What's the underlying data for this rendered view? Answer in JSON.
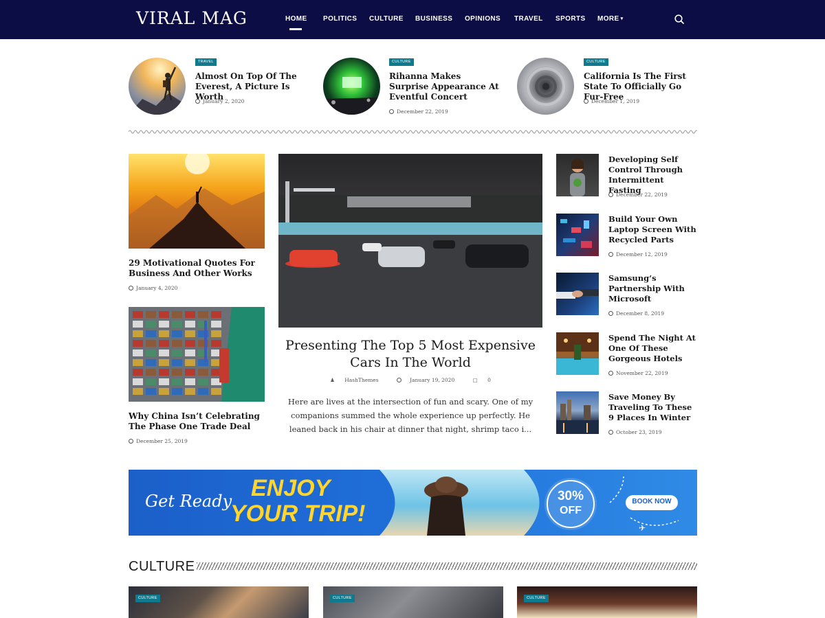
{
  "brand": {
    "logo": "VIRAL MAG"
  },
  "nav": {
    "items": [
      {
        "label": "HOME"
      },
      {
        "label": "POLITICS"
      },
      {
        "label": "CULTURE"
      },
      {
        "label": "BUSINESS"
      },
      {
        "label": "OPINIONS"
      },
      {
        "label": "TRAVEL"
      },
      {
        "label": "SPORTS"
      },
      {
        "label": "MORE"
      }
    ],
    "active": "HOME",
    "search_icon": "search-icon"
  },
  "featured": [
    {
      "category": "TRAVEL",
      "title": "Almost On Top Of The Everest, A Picture Is Worth",
      "date": "January 2, 2020"
    },
    {
      "category": "CULTURE",
      "title": "Rihanna Makes Surprise Appearance At Eventful Concert",
      "date": "December 22, 2019"
    },
    {
      "category": "CULTURE",
      "title": "California Is The First State To Officially Go Fur-Free",
      "date": "December 1, 2019"
    }
  ],
  "left_posts": [
    {
      "title": "29 Motivational Quotes For Business And Other Works",
      "date": "January 4, 2020"
    },
    {
      "title": "Why China Isn’t Celebrating The Phase One Trade Deal",
      "date": "December 25, 2019"
    }
  ],
  "main_post": {
    "title": "Presenting The Top 5 Most Expensive Cars In The World",
    "author": "HashThemes",
    "date": "January 19, 2020",
    "comments": "0",
    "excerpt": "Here are lives at the intersection of fun and scary. One of my companions summed the whole experience up perfectly. He leaned back in his chair at dinner that night, shrimp taco i..."
  },
  "side_posts": [
    {
      "title": "Developing Self Control Through Intermittent Fasting",
      "date": "December 22, 2019"
    },
    {
      "title": "Build Your Own Laptop Screen With Recycled Parts",
      "date": "December 12, 2019"
    },
    {
      "title": "Samsung’s Partnership With Microsoft",
      "date": "December 8, 2019"
    },
    {
      "title": "Spend The Night At One Of These Gorgeous Hotels",
      "date": "November 22, 2019"
    },
    {
      "title": "Save Money By Traveling To These 9 Places In Winter",
      "date": "October 23, 2019"
    }
  ],
  "banner": {
    "tagline": "Get Ready",
    "headline_1": "ENJOY",
    "headline_2": "YOUR TRIP!",
    "discount": "30%",
    "discount_label": "OFF",
    "cta": "BOOK NOW"
  },
  "culture": {
    "title": "CULTURE",
    "cards": [
      {
        "category": "CULTURE"
      },
      {
        "category": "CULTURE"
      },
      {
        "category": "CULTURE"
      }
    ]
  },
  "colors": {
    "header_bg": "#0d0d45",
    "badge_bg": "#0f7a8e",
    "banner_bg": "#1a6fd6",
    "banner_yellow": "#ffd52e"
  }
}
